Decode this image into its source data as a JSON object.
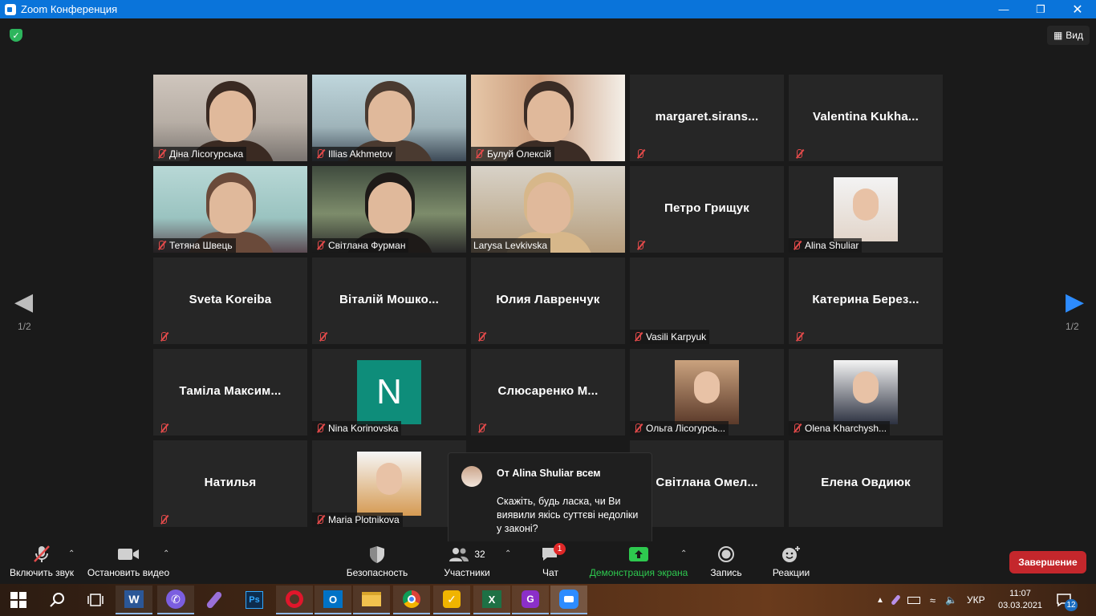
{
  "window": {
    "title": "Zoom Конференция"
  },
  "header": {
    "view_label": "Вид"
  },
  "nav": {
    "left_page": "1/2",
    "right_page": "1/2"
  },
  "tiles": [
    {
      "name": "Діна Лісогурська",
      "type": "video"
    },
    {
      "name": "Illias Akhmetov",
      "type": "video"
    },
    {
      "name": "Булуй Олексій",
      "type": "video"
    },
    {
      "name": "margaret.sirans...",
      "type": "name"
    },
    {
      "name": "Valentina  Kukha...",
      "type": "name"
    },
    {
      "name": "Тетяна Швець",
      "type": "video"
    },
    {
      "name": "Світлана Фурман",
      "type": "video"
    },
    {
      "name": "Larysa Levkivska",
      "type": "video",
      "active": true
    },
    {
      "name": "Петро Грищук",
      "type": "name"
    },
    {
      "name": "Alina Shuliar",
      "type": "avatar"
    },
    {
      "name": "Sveta Koreiba",
      "type": "name"
    },
    {
      "name": "Віталій  Мошко...",
      "type": "name"
    },
    {
      "name": "Юлия Лавренчук",
      "type": "name"
    },
    {
      "name": "Vasili Karpyuk",
      "type": "label"
    },
    {
      "name": "Катерина  Берез...",
      "type": "name"
    },
    {
      "name": "Таміла  Максим...",
      "type": "name"
    },
    {
      "name": "Nina Korinovska",
      "type": "letter",
      "letter": "N"
    },
    {
      "name": "Слюсаренко  М...",
      "type": "name"
    },
    {
      "name": "Ольга Лісогурсь...",
      "type": "avatar"
    },
    {
      "name": "Olena Kharchysh...",
      "type": "avatar"
    },
    {
      "name": "Натилья",
      "type": "name"
    },
    {
      "name": "Maria Plotnikova",
      "type": "avatar"
    },
    {
      "name": "",
      "type": "hidden"
    },
    {
      "name": "Світлана  Омел...",
      "type": "name"
    },
    {
      "name": "Елена Овдиюк",
      "type": "name",
      "unmuted": true
    }
  ],
  "chat_popup": {
    "from": "От Alina Shuliar всем",
    "message": "Скажіть, будь ласка, чи Ви виявили якісь суттєві недоліки у законі?"
  },
  "toolbar": {
    "audio": "Включить звук",
    "video": "Остановить видео",
    "security": "Безопасность",
    "participants": "Участники",
    "participants_count": "32",
    "chat": "Чат",
    "chat_badge": "1",
    "share": "Демонстрация экрана",
    "record": "Запись",
    "reactions": "Реакции",
    "end": "Завершение"
  },
  "taskbar": {
    "lang": "УКР",
    "time": "11:07",
    "date": "03.03.2021",
    "notifications": "12"
  },
  "colors": {
    "titlebar": "#0a74da",
    "share_green": "#2ec94f",
    "end_red": "#c4272c",
    "active_speaker": "#e8f05a"
  }
}
